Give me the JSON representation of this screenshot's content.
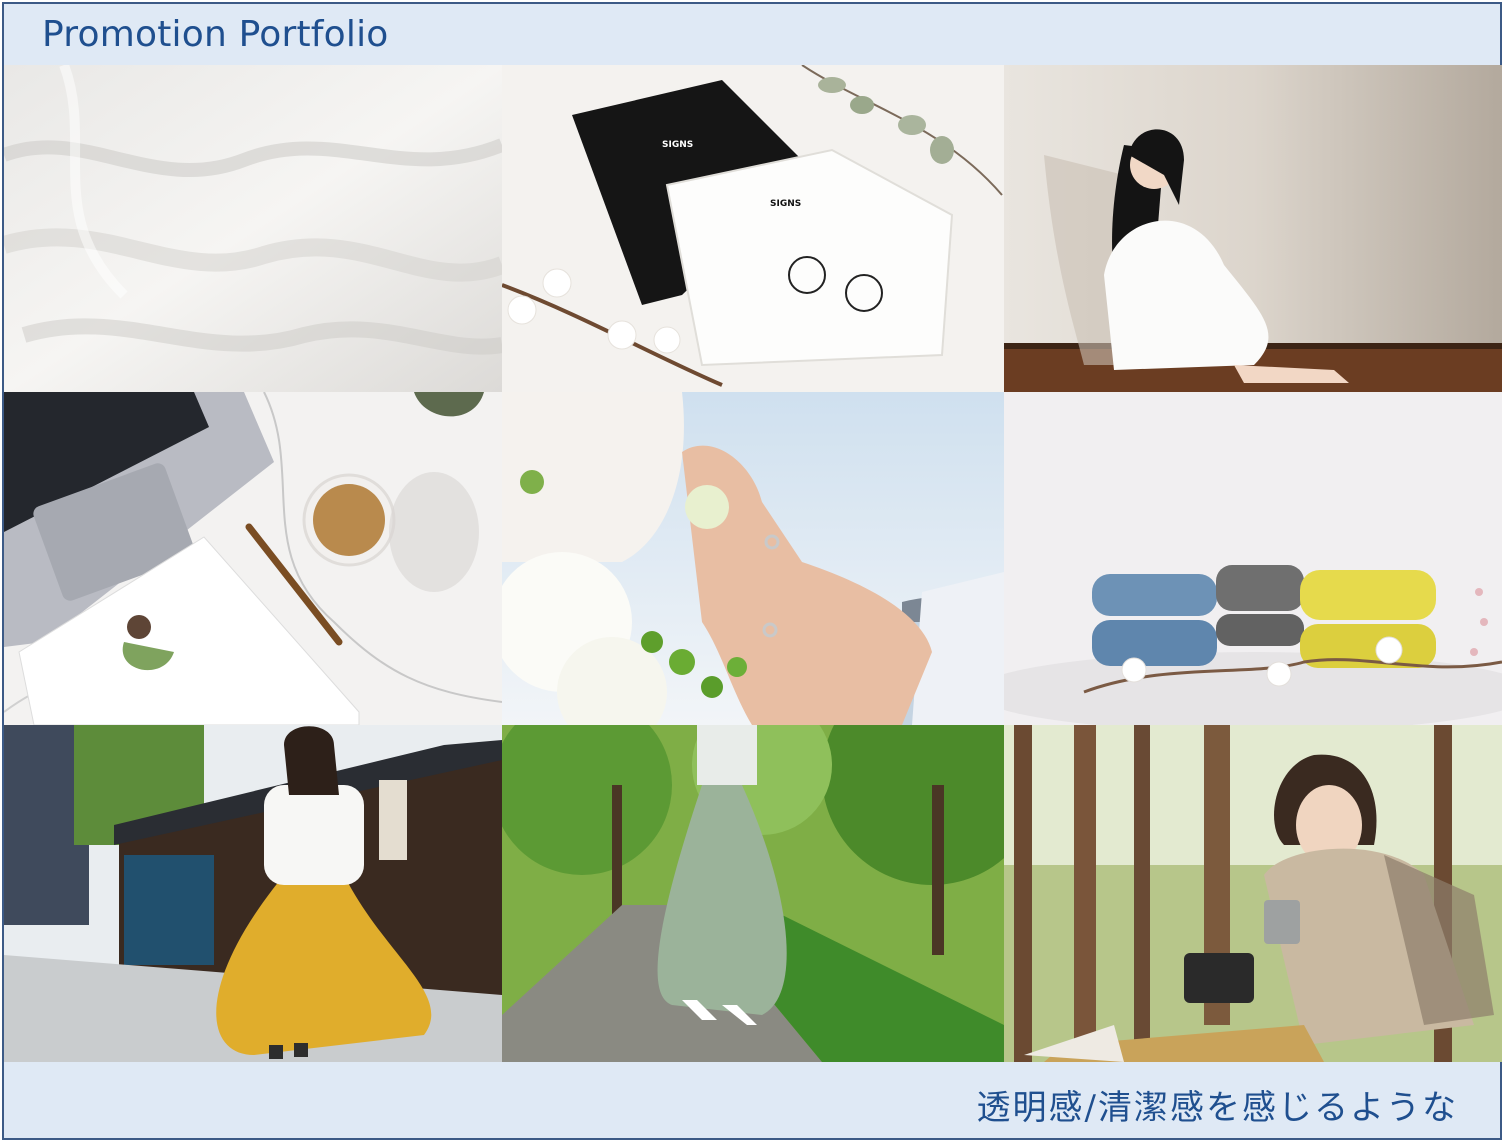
{
  "header": {
    "title": "Promotion Portfolio"
  },
  "footer": {
    "caption": "透明感/清潔感を感じるような"
  },
  "photos": [
    {
      "shirt_brand": "SIGNS"
    }
  ],
  "colors": {
    "frame_border": "#3c5a86",
    "band_bg": "#dfe9f5",
    "title_text": "#1f4f8f"
  }
}
